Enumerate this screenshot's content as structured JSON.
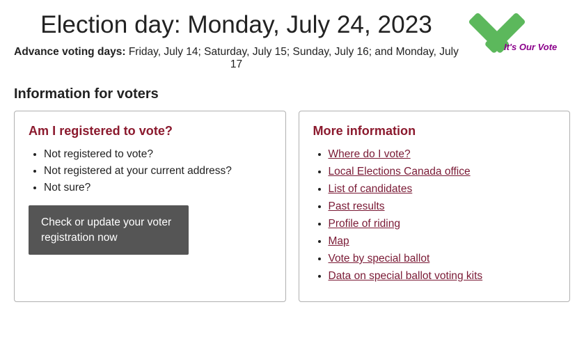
{
  "header": {
    "title": "Election day: Monday, July 24, 2023",
    "advance_label": "Advance voting days:",
    "advance_dates": "Friday, July 14; Saturday, July 15; Sunday, July 16; and Monday, July 17"
  },
  "logo": {
    "alt": "It's Our Vote",
    "tagline": "It's Our Vote"
  },
  "info_section": {
    "title": "Information for voters"
  },
  "card_left": {
    "title": "Am I registered to vote?",
    "bullets": [
      "Not registered to vote?",
      "Not registered at your current address?",
      "Not sure?"
    ],
    "button_label": "Check or update your voter registration now"
  },
  "card_right": {
    "title": "More information",
    "links": [
      "Where do I vote?",
      "Local Elections Canada office",
      "List of candidates",
      "Past results",
      "Profile of riding",
      "Map",
      "Vote by special ballot",
      "Data on special ballot voting kits"
    ]
  }
}
